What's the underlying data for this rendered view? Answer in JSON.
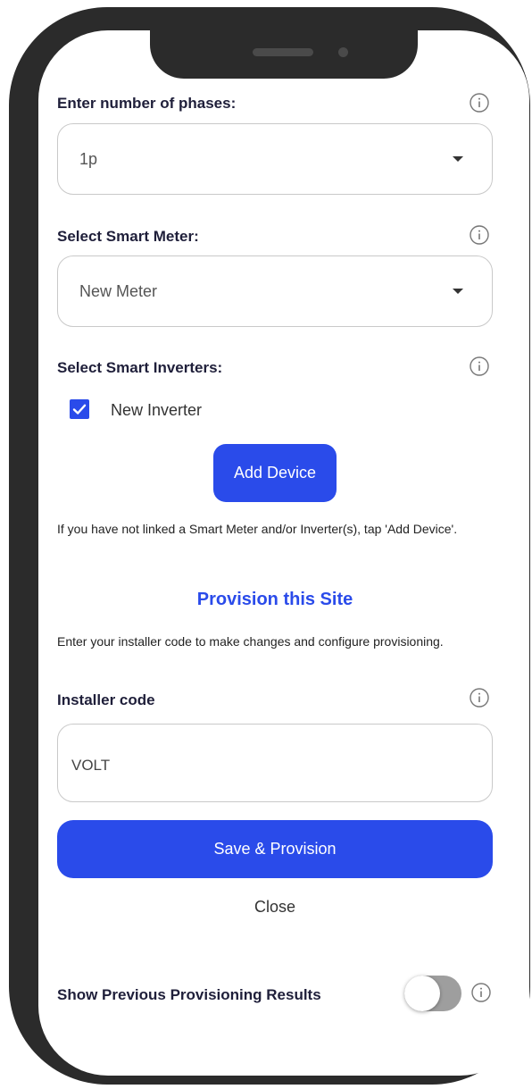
{
  "phases": {
    "label": "Enter number of phases:",
    "selected": "1p"
  },
  "smart_meter": {
    "label": "Select Smart Meter:",
    "selected": "New Meter"
  },
  "smart_inverters": {
    "label": "Select Smart Inverters:",
    "items": [
      {
        "label": "New Inverter",
        "checked": true
      }
    ]
  },
  "add_device_label": "Add Device",
  "add_device_hint": "If you have not linked a Smart Meter and/or Inverter(s), tap 'Add Device'.",
  "provision": {
    "title": "Provision this Site",
    "description": "Enter your installer code to make changes and configure provisioning.",
    "installer_code_label": "Installer code",
    "installer_code_value": "VOLT",
    "save_label": "Save & Provision",
    "close_label": "Close"
  },
  "previous_results": {
    "label": "Show Previous Provisioning Results",
    "toggle_on": false
  },
  "icons": {
    "info": "info-circle-icon",
    "caret": "caret-down-icon",
    "check": "checkmark-icon"
  },
  "colors": {
    "accent": "#2a4bea",
    "text_dark": "#1f1f3a",
    "border": "#c9c9c9",
    "toggle_off": "#9e9e9e",
    "device_frame": "#2b2b2b"
  }
}
